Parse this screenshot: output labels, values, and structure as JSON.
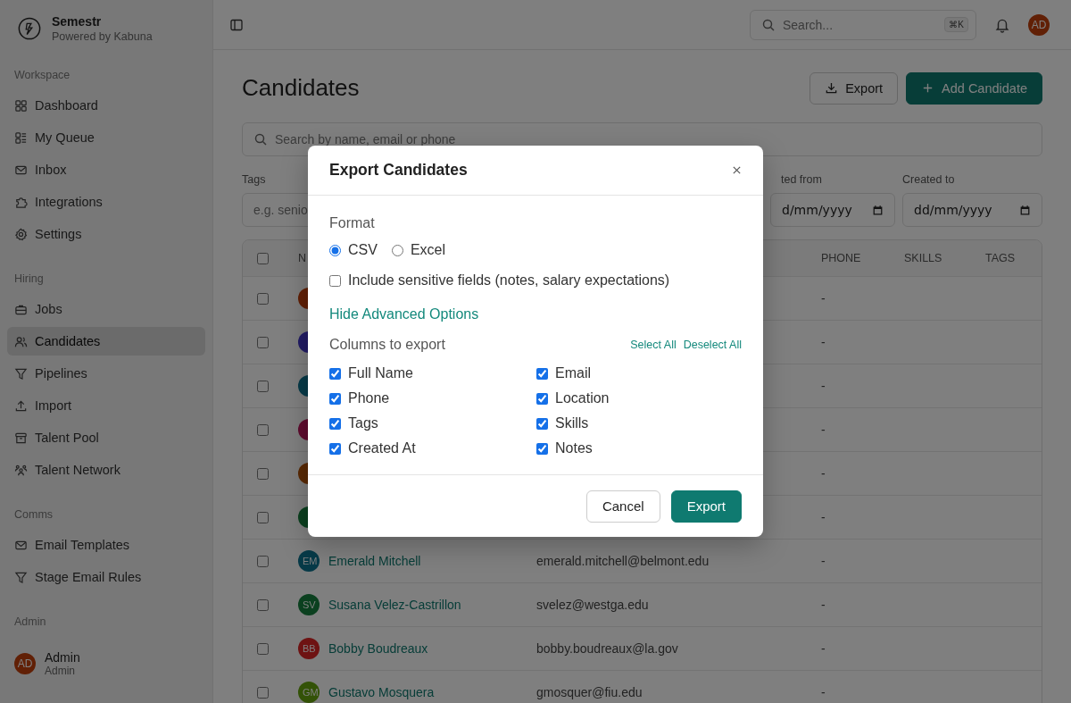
{
  "sidebar": {
    "brand": {
      "name": "Semestr",
      "tagline": "Powered by Kabuna"
    },
    "sections": [
      {
        "title": "Workspace",
        "items": [
          {
            "label": "Dashboard",
            "selected": false
          },
          {
            "label": "My Queue",
            "selected": false
          },
          {
            "label": "Inbox",
            "selected": false
          },
          {
            "label": "Integrations",
            "selected": false
          },
          {
            "label": "Settings",
            "selected": false
          }
        ]
      },
      {
        "title": "Hiring",
        "items": [
          {
            "label": "Jobs",
            "selected": false
          },
          {
            "label": "Candidates",
            "selected": true
          },
          {
            "label": "Pipelines",
            "selected": false
          },
          {
            "label": "Import",
            "selected": false
          },
          {
            "label": "Talent Pool",
            "selected": false
          },
          {
            "label": "Talent Network",
            "selected": false
          }
        ]
      },
      {
        "title": "Comms",
        "items": [
          {
            "label": "Email Templates",
            "selected": false
          },
          {
            "label": "Stage Email Rules",
            "selected": false
          }
        ]
      },
      {
        "title": "Admin"
      }
    ],
    "user": {
      "initials": "AD",
      "name": "Admin",
      "role": "Admin"
    }
  },
  "topbar": {
    "search": {
      "placeholder": "Search...",
      "shortcut": "⌘K"
    },
    "avatar": "AD"
  },
  "page": {
    "title": "Candidates",
    "actions": [
      {
        "label": "Export",
        "kind": "outline"
      },
      {
        "label": "Add Candidate",
        "kind": "primary"
      }
    ],
    "search": {
      "placeholder": "Search by name, email or phone"
    },
    "filters": [
      {
        "label": "Tags",
        "placeholder": "e.g. senio",
        "kind": "text"
      },
      {
        "label": "ted from",
        "placeholder": "d/mm/yyyy",
        "kind": "date"
      },
      {
        "label": "Created to",
        "placeholder": "dd/mm/yyyy",
        "kind": "date"
      }
    ]
  },
  "table": {
    "all_selected": false,
    "columns": [
      "N",
      "PHONE",
      "SKILLS",
      "TAGS"
    ],
    "rows": [
      {
        "selected": false,
        "color": "#612006",
        "phone": "-"
      },
      {
        "selected": false,
        "color": "#221c65",
        "phone": "-"
      },
      {
        "selected": false,
        "color": "#073a48",
        "phone": "-"
      },
      {
        "selected": false,
        "color": "#5f0c2f",
        "phone": "-"
      },
      {
        "selected": false,
        "color": "#5a2a05",
        "phone": "-"
      },
      {
        "selected": false,
        "color": "#0b401f",
        "phone": "-"
      },
      {
        "selected": false,
        "initials": "EM",
        "color": "#073a48",
        "name": "Emerald Mitchell",
        "email": "emerald.mitchell@belmont.edu",
        "phone": "-"
      },
      {
        "selected": false,
        "initials": "SV",
        "color": "#0b401f",
        "name": "Susana Velez-Castrillon",
        "email": "svelez@westga.edu",
        "phone": "-"
      },
      {
        "selected": false,
        "initials": "BB",
        "color": "#6e1313",
        "name": "Bobby Boudreaux",
        "email": "bobby.boudreaux@la.gov",
        "phone": "-"
      },
      {
        "selected": false,
        "initials": "GM",
        "color": "#335207",
        "name": "Gustavo Mosquera",
        "email": "gmosquer@fiu.edu",
        "phone": "-"
      }
    ]
  },
  "dialog": {
    "title": "Export Candidates",
    "format": {
      "label": "Format",
      "options": [
        {
          "label": "CSV",
          "selected": true
        },
        {
          "label": "Excel",
          "selected": false
        }
      ]
    },
    "sensitive": {
      "label": "Include sensitive fields (notes, salary expectations)",
      "checked": false
    },
    "advanced_toggle": "Hide Advanced Options",
    "columns": {
      "label": "Columns to export",
      "select_all": "Select All",
      "deselect_all": "Deselect All",
      "items": [
        {
          "label": "Full Name",
          "checked": true
        },
        {
          "label": "Email",
          "checked": true
        },
        {
          "label": "Phone",
          "checked": true
        },
        {
          "label": "Location",
          "checked": true
        },
        {
          "label": "Tags",
          "checked": true
        },
        {
          "label": "Skills",
          "checked": true
        },
        {
          "label": "Created At",
          "checked": true
        },
        {
          "label": "Notes",
          "checked": true
        }
      ]
    },
    "buttons": [
      {
        "label": "Cancel",
        "kind": "secondary"
      },
      {
        "label": "Export",
        "kind": "primary"
      }
    ]
  }
}
